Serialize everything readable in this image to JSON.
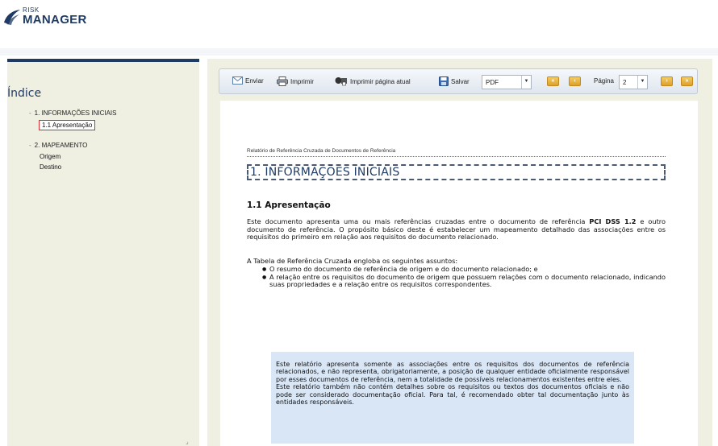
{
  "brand": {
    "small": "RISK",
    "big": "MANAGER"
  },
  "sidebar": {
    "title": "Índice",
    "sections": [
      {
        "label": "1. INFORMAÇÕES INICIAIS",
        "items": [
          "1.1 Apresentação"
        ]
      },
      {
        "label": "2. MAPEAMENTO",
        "items": [
          "Origem",
          "Destino"
        ]
      }
    ],
    "bullet": "-"
  },
  "toolbar": {
    "send": "Enviar",
    "print": "Imprimir",
    "print_current": "Imprimir página atual",
    "save": "Salvar",
    "format": "PDF",
    "page_label": "Página",
    "page": "2"
  },
  "document": {
    "header": "Relatório de Referência Cruzada de Documentos de Referência",
    "section_title": "1. INFORMAÇÕES INICIAIS",
    "subsection_title": "1.1 Apresentação",
    "p1_before": "Este documento apresenta uma ou mais referências cruzadas entre o documento de referência ",
    "p1_bold": "PCI DSS 1.2",
    "p1_after": "  e outro documento de referência. O propósito básico deste é estabelecer um mapeamento detalhado das associações entre os requisitos do primeiro em relação aos requisitos do documento relacionado.",
    "p2": "A Tabela de Referência Cruzada engloba os seguintes assuntos:",
    "bullets": [
      "O resumo do documento de referência de origem e do documento relacionado; e",
      "A relação entre os requisitos do documento de origem que possuem relações com o documento relacionado, indicando suas propriedades e a relação entre os requisitos correspondentes."
    ],
    "note_p1": "Este relatório apresenta somente as associações entre os requisitos dos documentos de referência relacionados, e não representa, obrigatoriamente, a posição de qualquer entidade oficialmente responsável por esses documentos de referência, nem a totalidade de possíveis relacionamentos existentes entre eles.",
    "note_p2": "Este relatório também não contém detalhes sobre os requisitos ou textos dos documentos oficiais e não pode ser considerado documentação oficial. Para tal, é recomendado obter tal documentação junto às entidades responsáveis."
  },
  "colors": {
    "brand": "#1f3b63",
    "pane_bg": "#efefe2",
    "note_bg": "#d8e6f6",
    "highlight": "#d92b2b"
  }
}
